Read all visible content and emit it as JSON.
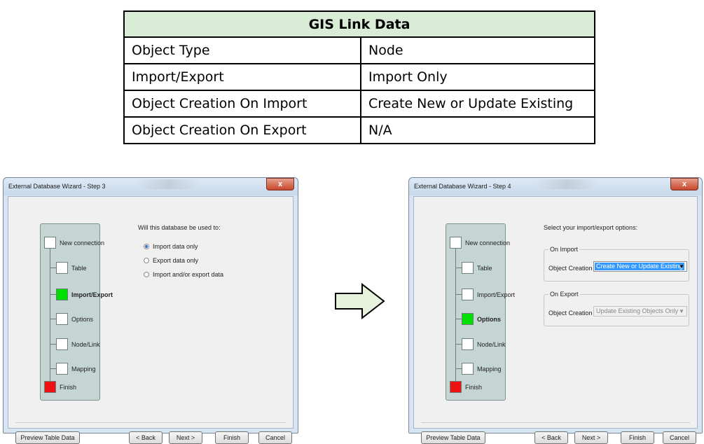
{
  "table": {
    "title": "GIS Link Data",
    "rows": [
      {
        "label": "Object Type",
        "value": "Node"
      },
      {
        "label": "Import/Export",
        "value": "Import Only"
      },
      {
        "label": "Object Creation On Import",
        "value": "Create New or Update Existing"
      },
      {
        "label": "Object Creation On Export",
        "value": "N/A"
      }
    ]
  },
  "colors": {
    "table_header": "#d9ecd5",
    "step_panel": "#c5d5d3",
    "step_active": "#00e000",
    "step_finish": "#ee1111",
    "arrow_fill": "#e6f2dc"
  },
  "step3": {
    "title": "External Database Wizard - Step 3",
    "close_label": "x",
    "steps": [
      "New connection",
      "Table",
      "Import/Export",
      "Options",
      "Node/Link",
      "Mapping",
      "Finish"
    ],
    "active_step": "Import/Export",
    "prompt": "Will this database be used to:",
    "options": [
      {
        "label": "Import data only",
        "checked": true
      },
      {
        "label": "Export data only",
        "checked": false
      },
      {
        "label": "Import and/or export data",
        "checked": false
      }
    ],
    "buttons": {
      "preview": "Preview Table Data",
      "back": "< Back",
      "next": "Next >",
      "finish": "Finish",
      "cancel": "Cancel"
    }
  },
  "step4": {
    "title": "External Database Wizard - Step 4",
    "close_label": "x",
    "steps": [
      "New connection",
      "Table",
      "Import/Export",
      "Options",
      "Node/Link",
      "Mapping",
      "Finish"
    ],
    "active_step": "Options",
    "prompt": "Select your import/export options:",
    "on_import": {
      "legend": "On Import",
      "field_label": "Object Creation",
      "value": "Create New or Update Existing"
    },
    "on_export": {
      "legend": "On Export",
      "field_label": "Object Creation",
      "value": "Update Existing Objects Only"
    },
    "buttons": {
      "preview": "Preview Table Data",
      "back": "< Back",
      "next": "Next >",
      "finish": "Finish",
      "cancel": "Cancel"
    }
  },
  "transition_icon": "right-arrow-icon"
}
